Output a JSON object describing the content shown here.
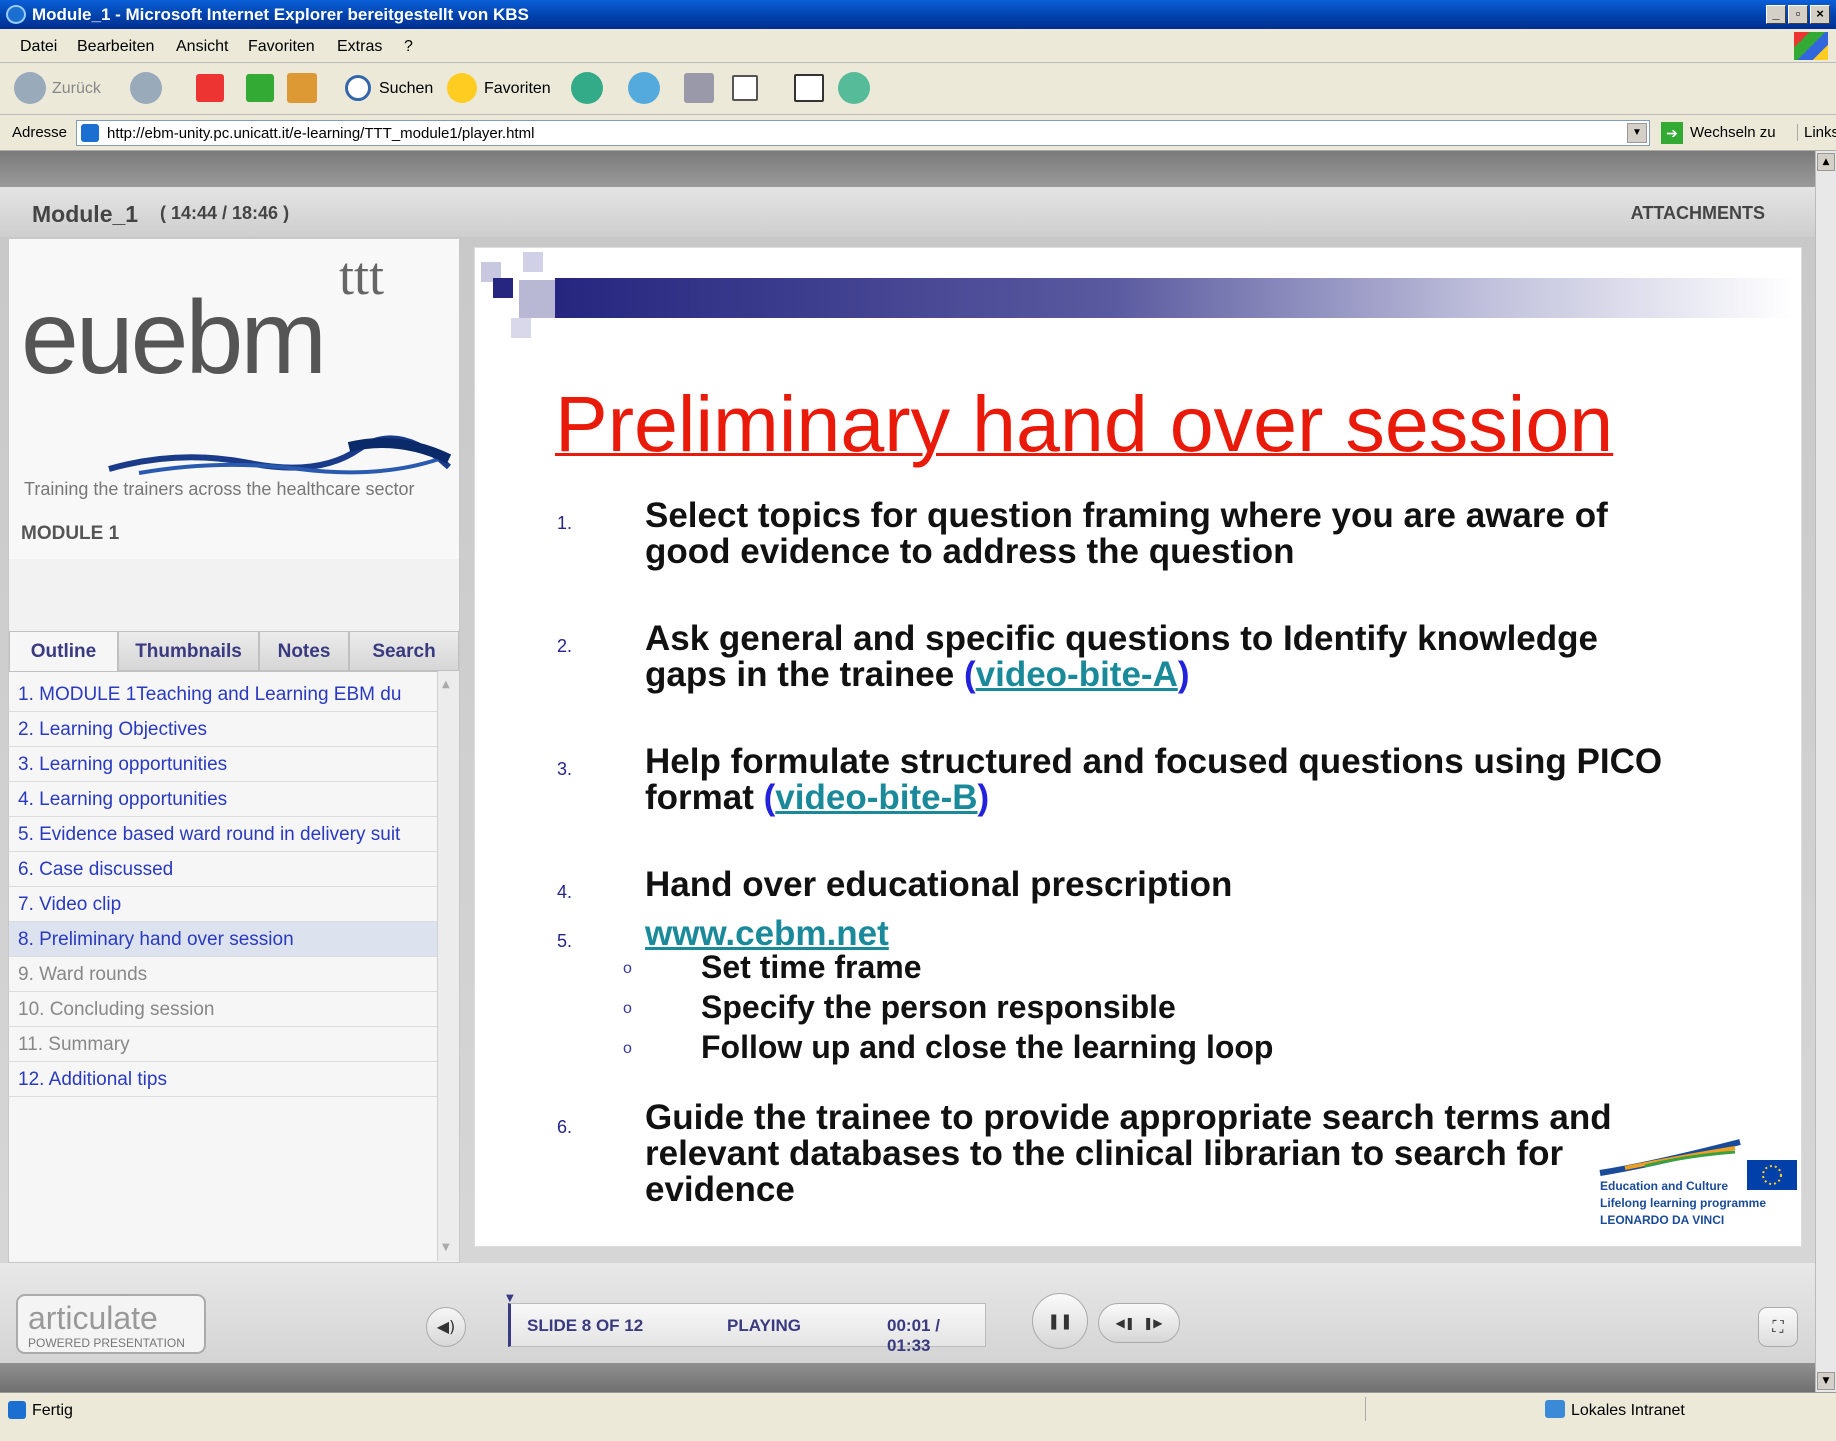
{
  "window": {
    "title": "Module_1 - Microsoft Internet Explorer bereitgestellt von KBS"
  },
  "menu": [
    "Datei",
    "Bearbeiten",
    "Ansicht",
    "Favoriten",
    "Extras",
    "?"
  ],
  "toolbar": {
    "back": "Zurück",
    "search": "Suchen",
    "favorites": "Favoriten"
  },
  "address": {
    "label": "Adresse",
    "url": "http://ebm-unity.pc.unicatt.it/e-learning/TTT_module1/player.html",
    "go": "Wechseln zu",
    "links": "Links"
  },
  "player": {
    "module_title": "Module_1",
    "time": "( 14:44 / 18:46 )",
    "attachments": "ATTACHMENTS",
    "logo": {
      "main": "euebm",
      "sup": "ttt",
      "tagline": "Training the trainers across the healthcare sector"
    },
    "module_label": "MODULE 1",
    "tabs": [
      "Outline",
      "Thumbnails",
      "Notes",
      "Search"
    ],
    "outline": [
      "1. MODULE 1Teaching and Learning EBM du",
      "2. Learning Objectives",
      "3. Learning opportunities",
      "4. Learning opportunities",
      "5. Evidence based ward round in delivery suit",
      "6. Case discussed",
      "7. Video clip",
      "8. Preliminary hand over session",
      "9. Ward rounds",
      "10. Concluding session",
      "11. Summary",
      "12. Additional tips"
    ],
    "slide": {
      "title": "Preliminary hand over session",
      "items": [
        {
          "n": "1.",
          "l1": "Select topics for question framing where you are aware of",
          "l2": "good evidence to address the question"
        },
        {
          "n": "2.",
          "l1": "Ask general and specific questions to Identify knowledge",
          "l2a": "gaps in the trainee ",
          "link_a": "video-bite-A"
        },
        {
          "n": "3.",
          "l1": "Help formulate structured and focused questions using PICO",
          "l2a": "format ",
          "link_b": "video-bite-B"
        },
        {
          "n": "4.",
          "l1": "Hand over educational prescription"
        },
        {
          "n": "5.",
          "link": "www.cebm.net"
        },
        {
          "n": "6.",
          "l1": "Guide the trainee to provide appropriate search terms and",
          "l2": "relevant databases to the clinical librarian to search for",
          "l3": "evidence"
        }
      ],
      "subs": [
        "Set time frame",
        "Specify the person responsible",
        "Follow up and close the learning loop"
      ],
      "bullet": "o",
      "eu": {
        "l1": "Education and Culture",
        "l2": "Lifelong learning programme",
        "l3": "LEONARDO DA VINCI"
      }
    },
    "controls": {
      "articulate": "articulate",
      "powered": "POWERED PRESENTATION",
      "slide": "SLIDE 8 OF 12",
      "state": "PLAYING",
      "time": "00:01 / 01:33"
    }
  },
  "status": {
    "text": "Fertig",
    "zone": "Lokales Intranet"
  }
}
